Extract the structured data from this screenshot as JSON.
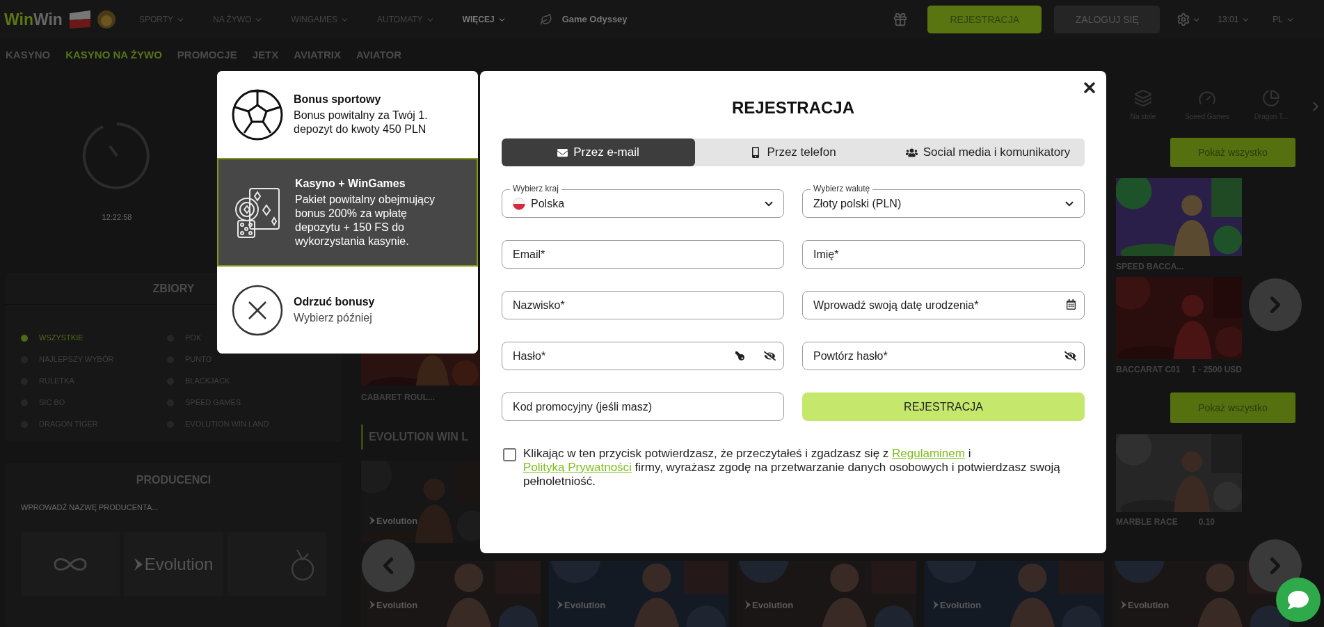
{
  "header": {
    "logo": [
      "Win",
      "Win"
    ],
    "nav": [
      {
        "label": "SPORTY",
        "emphasis": false
      },
      {
        "label": "NA ŻYWO",
        "emphasis": false
      },
      {
        "label": "WINGAMES",
        "emphasis": false
      },
      {
        "label": "AUTOMATY",
        "emphasis": false
      },
      {
        "label": "WIĘCEJ",
        "emphasis": true
      }
    ],
    "game": "Game Odyssey",
    "register": "REJESTRACJA",
    "login": "ZALOGUJ SIĘ",
    "time": "13:01",
    "language": "PL"
  },
  "subnav": [
    {
      "label": "KASYNO",
      "selected": false
    },
    {
      "label": "KASYNO NA ŻYWO",
      "selected": true
    },
    {
      "label": "PROMOCJE",
      "selected": false
    },
    {
      "label": "JETX",
      "selected": false
    },
    {
      "label": "AVIATRIX",
      "selected": false
    },
    {
      "label": "AVIATOR",
      "selected": false
    }
  ],
  "sidebar": {
    "timer": "12:22:58",
    "collections_title": "ZBIORY",
    "collections": [
      {
        "label": "WSZYSTKIE",
        "selected": true
      },
      {
        "label": "NAJLEPSZY WYBÓR",
        "selected": false
      },
      {
        "label": "RULETKA",
        "selected": false
      },
      {
        "label": "SIC BO",
        "selected": false
      },
      {
        "label": "DRAGON TIGER",
        "selected": false
      },
      {
        "label": "POK",
        "selected": false
      },
      {
        "label": "PUNTO",
        "selected": false
      },
      {
        "label": "BLACKJACK",
        "selected": false
      },
      {
        "label": "SPEED GAMES",
        "selected": false
      },
      {
        "label": "EVOLUTION WIN LAND",
        "selected": false
      }
    ],
    "producers_title": "PRODUCENCI",
    "producer_search": {
      "placeholder": "WPROWADŹ NAZWĘ PRODUCENTA..."
    },
    "producer_logo": "Evolution"
  },
  "left_column": {
    "game_label": "CABARET ROUL...",
    "section_title": "EVOLUTION WIN L",
    "tile_provider": "Evolution"
  },
  "right_column": {
    "categories": [
      "Na stole",
      "Speed Games",
      "Dragon T..."
    ],
    "buttons": [
      "Pokaż wszystko",
      "Pokaż wszystko"
    ],
    "games": [
      {
        "name": "SPEED BACCA..."
      },
      {
        "name": "BACCARAT C01",
        "limit": "1 - 2500 USD"
      },
      {
        "name": "MARBLE RACE",
        "limit": "0.10"
      }
    ]
  },
  "bottom_row": [
    {
      "provider": "Evolution"
    },
    {
      "provider": "Evolution"
    },
    {
      "provider": "Evolution"
    },
    {
      "provider": "Evolution"
    },
    {
      "provider": "Evolution"
    }
  ],
  "bonus_options": [
    {
      "kind": "sport",
      "title": "Bonus sportowy",
      "description": "Bonus powitalny za Twój 1. depozyt do kwoty 450 PLN",
      "selected": false
    },
    {
      "kind": "casino",
      "title": "Kasyno + WinGames",
      "description": "Pakiet powitalny obejmujący bonus 200% za wpłatę depozytu + 150 FS do wykorzystania kasynie.",
      "selected": true
    },
    {
      "kind": "decline",
      "title": "Odrzuć bonusy",
      "description": "Wybierz później",
      "selected": false
    }
  ],
  "registration": {
    "title": "REJESTRACJA",
    "tabs": [
      {
        "kind": "email",
        "label": "Przez e-mail",
        "selected": true
      },
      {
        "kind": "phone",
        "label": "Przez telefon",
        "selected": false
      },
      {
        "kind": "social",
        "label": "Social media i komunikatory",
        "selected": false
      }
    ],
    "country": {
      "label": "Wybierz kraj",
      "value": "Polska"
    },
    "currency": {
      "label": "Wybierz walutę",
      "value": "Złoty polski (PLN)"
    },
    "fields": [
      {
        "kind": "text",
        "placeholder": "Email*"
      },
      {
        "kind": "text",
        "placeholder": "Imię*"
      },
      {
        "kind": "text",
        "placeholder": "Nazwisko*"
      },
      {
        "kind": "date",
        "placeholder": "Wprowadź swoją datę urodzenia*"
      },
      {
        "kind": "password_generator",
        "placeholder": "Hasło*"
      },
      {
        "kind": "password",
        "placeholder": "Powtórz hasło*"
      },
      {
        "kind": "text",
        "placeholder": "Kod promocyjny (jeśli masz)"
      }
    ],
    "submit": "REJESTRACJA",
    "consent": {
      "checked": false,
      "parts": [
        {
          "kind": "text",
          "text": "Klikając w ten przycisk potwierdzasz, że przeczytałeś i zgadzasz się z "
        },
        {
          "kind": "link",
          "text": "Regulaminem"
        },
        {
          "kind": "text",
          "text": " i "
        },
        {
          "kind": "link",
          "text": "Polityką Prywatności"
        },
        {
          "kind": "text",
          "text": " firmy, wyrażasz zgodę na przetwarzanie danych osobowych i potwierdzasz swoją pełnoletniość."
        }
      ]
    }
  }
}
